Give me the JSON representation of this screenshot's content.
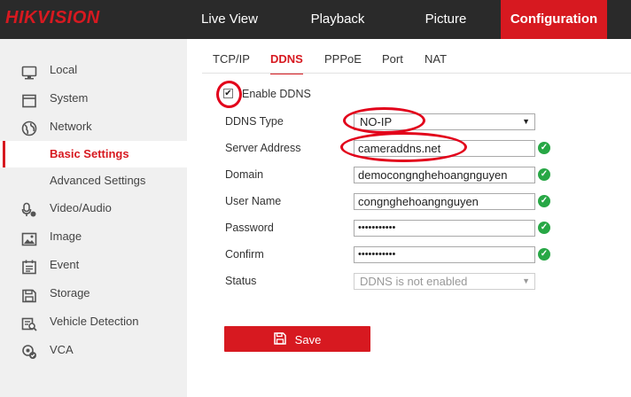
{
  "brand": {
    "logo_text": "HIKVISION",
    "accent": "#d71920"
  },
  "nav": {
    "tabs": [
      {
        "label": "Live View"
      },
      {
        "label": "Playback"
      },
      {
        "label": "Picture"
      },
      {
        "label": "Configuration",
        "active": true
      }
    ]
  },
  "sidebar": {
    "items": [
      {
        "label": "Local",
        "icon": "monitor-icon"
      },
      {
        "label": "System",
        "icon": "system-icon"
      },
      {
        "label": "Network",
        "icon": "globe-icon"
      },
      {
        "label": "Basic Settings",
        "selected": true
      },
      {
        "label": "Advanced Settings"
      },
      {
        "label": "Video/Audio",
        "icon": "microphone-icon"
      },
      {
        "label": "Image",
        "icon": "image-icon"
      },
      {
        "label": "Event",
        "icon": "event-icon"
      },
      {
        "label": "Storage",
        "icon": "storage-icon"
      },
      {
        "label": "Vehicle Detection",
        "icon": "vehicle-detection-icon"
      },
      {
        "label": "VCA",
        "icon": "vca-icon"
      }
    ]
  },
  "subtabs": [
    {
      "label": "TCP/IP"
    },
    {
      "label": "DDNS",
      "active": true
    },
    {
      "label": "PPPoE"
    },
    {
      "label": "Port"
    },
    {
      "label": "NAT"
    }
  ],
  "form": {
    "enable_ddns": {
      "label": "Enable DDNS",
      "checked": true
    },
    "ddns_type": {
      "label": "DDNS Type",
      "value": "NO-IP"
    },
    "server_address": {
      "label": "Server Address",
      "value": "cameraddns.net"
    },
    "domain": {
      "label": "Domain",
      "value": "democongnghehoangnguyen"
    },
    "user_name": {
      "label": "User Name",
      "value": "congnghehoangnguyen"
    },
    "password": {
      "label": "Password",
      "value": "•••••••••••"
    },
    "confirm": {
      "label": "Confirm",
      "value": "•••••••••••"
    },
    "status": {
      "label": "Status",
      "value": "DDNS is not enabled"
    }
  },
  "save_button": {
    "label": "Save"
  },
  "colors": {
    "valid": "#27a745",
    "annotation": "#e2001a",
    "sidebar_bg": "#f0f0f0",
    "topbar_bg": "#2a2a2a"
  }
}
